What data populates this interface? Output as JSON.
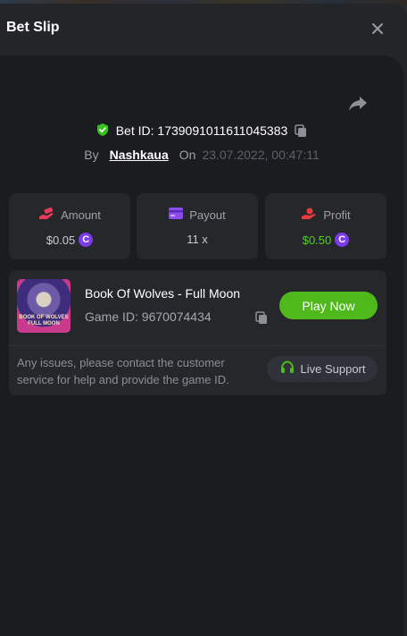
{
  "header": {
    "title": "Bet Slip"
  },
  "bet": {
    "id_text": "Bet ID: 1739091011611045383",
    "by_label": "By",
    "user": "Nashkaua",
    "on_label": "On",
    "date": "23.07.2022, 00:47:11"
  },
  "stats": {
    "amount": {
      "label": "Amount",
      "value": "$0.05",
      "icon": "hand-money-icon"
    },
    "payout": {
      "label": "Payout",
      "value": "11 x",
      "icon": "card-icon"
    },
    "profit": {
      "label": "Profit",
      "value": "$0.50",
      "icon": "hand-coin-icon"
    }
  },
  "game": {
    "title": "Book Of Wolves - Full Moon",
    "id_text": "Game ID: 9670074434",
    "thumb_text": "BOOK OF WOLVES FULL MOON",
    "play_label": "Play Now"
  },
  "support": {
    "text": "Any issues, please contact the customer service for help and provide the game ID.",
    "button_label": "Live Support"
  },
  "colors": {
    "accent_green": "#4fb81b",
    "profit_green": "#56cf1f",
    "coin_purple": "#7b3bea",
    "verified_green": "#35c01a"
  }
}
